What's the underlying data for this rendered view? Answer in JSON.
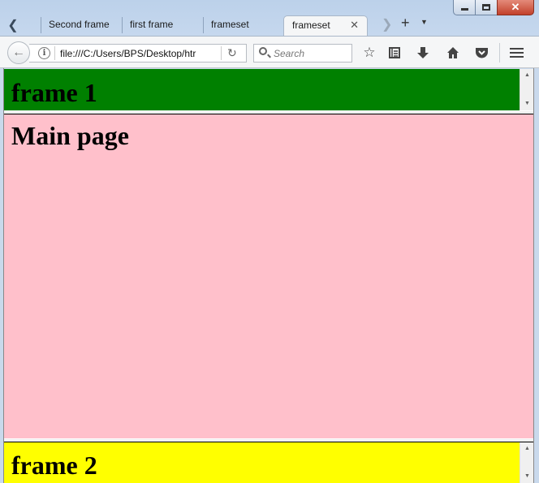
{
  "window": {
    "controls": {
      "minimize": "",
      "maximize": "",
      "close": "✕"
    }
  },
  "tabs": [
    {
      "label": "Second frame"
    },
    {
      "label": "first frame"
    },
    {
      "label": "frameset"
    },
    {
      "label": "frameset",
      "active": true
    }
  ],
  "toolbar": {
    "url": "file:///C:/Users/BPS/Desktop/htr",
    "search_placeholder": "Search",
    "icons": [
      "back-icon",
      "info-icon",
      "reload-icon",
      "search-icon",
      "bookmark-star-icon",
      "reading-list-icon",
      "download-icon",
      "home-icon",
      "pocket-icon",
      "menu-icon"
    ]
  },
  "frames": {
    "frame1": {
      "heading": "frame 1",
      "background": "#008000"
    },
    "main": {
      "heading": "Main page",
      "background": "#ffc0cb"
    },
    "frame2": {
      "heading": "frame 2",
      "background": "#ffff00"
    }
  }
}
